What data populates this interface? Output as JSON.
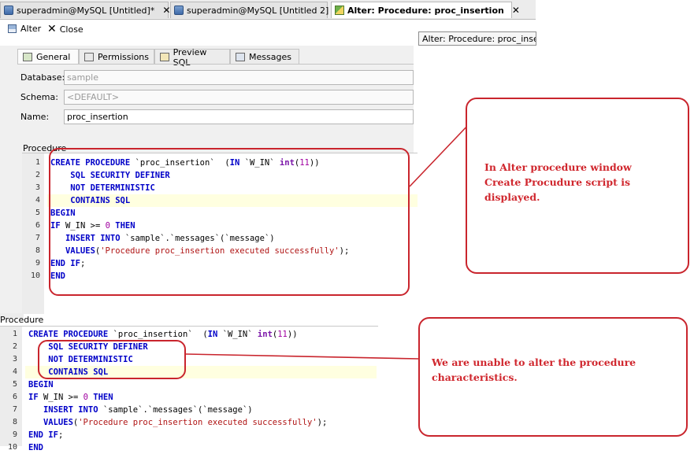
{
  "tabs": [
    {
      "label": "superadmin@MySQL [Untitled]*",
      "active": false
    },
    {
      "label": "superadmin@MySQL [Untitled 2]",
      "active": false
    },
    {
      "label": "Alter: Procedure: proc_insertion",
      "active": true
    }
  ],
  "toolbar": {
    "alter_label": "Alter",
    "close_label": "Close"
  },
  "tooltip": "Alter: Procedure: proc_insertion",
  "subtabs": [
    "General",
    "Permissions",
    "Preview SQL",
    "Messages"
  ],
  "form": {
    "database_label": "Database:",
    "database_value": "sample",
    "schema_label": "Schema:",
    "schema_value": "<DEFAULT>",
    "name_label": "Name:",
    "name_value": "proc_insertion",
    "procedure_label": "Procedure"
  },
  "lower": {
    "procedure_label": "Procedure"
  },
  "code": {
    "line_numbers": [
      "1",
      "2",
      "3",
      "4",
      "5",
      "6",
      "7",
      "8",
      "9",
      "10"
    ],
    "upper_lines": [
      "CREATE PROCEDURE `proc_insertion`  (IN `W_IN` int(11))",
      "    SQL SECURITY DEFINER",
      "    NOT DETERMINISTIC",
      "    CONTAINS SQL",
      "BEGIN",
      "IF W_IN >= 0 THEN",
      "   INSERT INTO `sample`.`messages`(`message`)",
      "   VALUES('Procedure proc_insertion executed successfully');",
      "END IF;",
      "END"
    ],
    "lower_lines": [
      "CREATE PROCEDURE `proc_insertion`  (IN `W_IN` int(11))",
      "    SQL SECURITY DEFINER",
      "    NOT DETERMINISTIC",
      "    CONTAINS SQL",
      "BEGIN",
      "IF W_IN >= 0 THEN",
      "   INSERT INTO `sample`.`messages`(`message`)",
      "   VALUES('Procedure proc_insertion executed successfully');",
      "END IF;",
      "END"
    ]
  },
  "annotations": {
    "note1": [
      "In Alter procedure window",
      "Create Procudure script is",
      "displayed."
    ],
    "note2": [
      "We are unable to alter the procedure",
      "characteristics."
    ]
  },
  "colors": {
    "annotation_red": "#c9252d",
    "keyword_blue": "#0000c8",
    "string_red": "#b01515",
    "number_purple": "#a000a0"
  }
}
